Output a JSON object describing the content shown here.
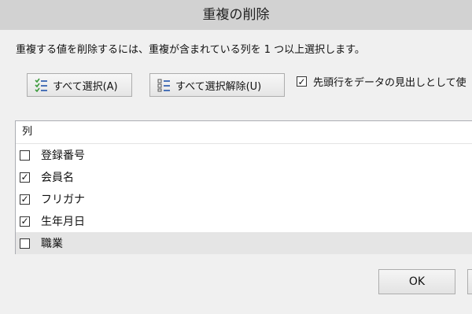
{
  "window": {
    "title": "重複の削除"
  },
  "instruction": "重複する値を削除するには、重複が含まれている列を 1 つ以上選択します。",
  "buttons": {
    "select_all": "すべて選択(A)",
    "deselect_all": "すべて選択解除(U)",
    "ok": "OK"
  },
  "header_option": {
    "label": "先頭行をデータの見出しとして使",
    "checked": true
  },
  "columns": {
    "header": "列",
    "items": [
      {
        "label": "登録番号",
        "checked": false
      },
      {
        "label": "会員名",
        "checked": true
      },
      {
        "label": "フリガナ",
        "checked": true
      },
      {
        "label": "生年月日",
        "checked": true
      },
      {
        "label": "職業",
        "checked": false,
        "selected": true
      }
    ]
  },
  "colors": {
    "titlebar": "#d2d2d2",
    "selected_row": "#e5e5e5",
    "icon_green": "#3c9a3c"
  }
}
